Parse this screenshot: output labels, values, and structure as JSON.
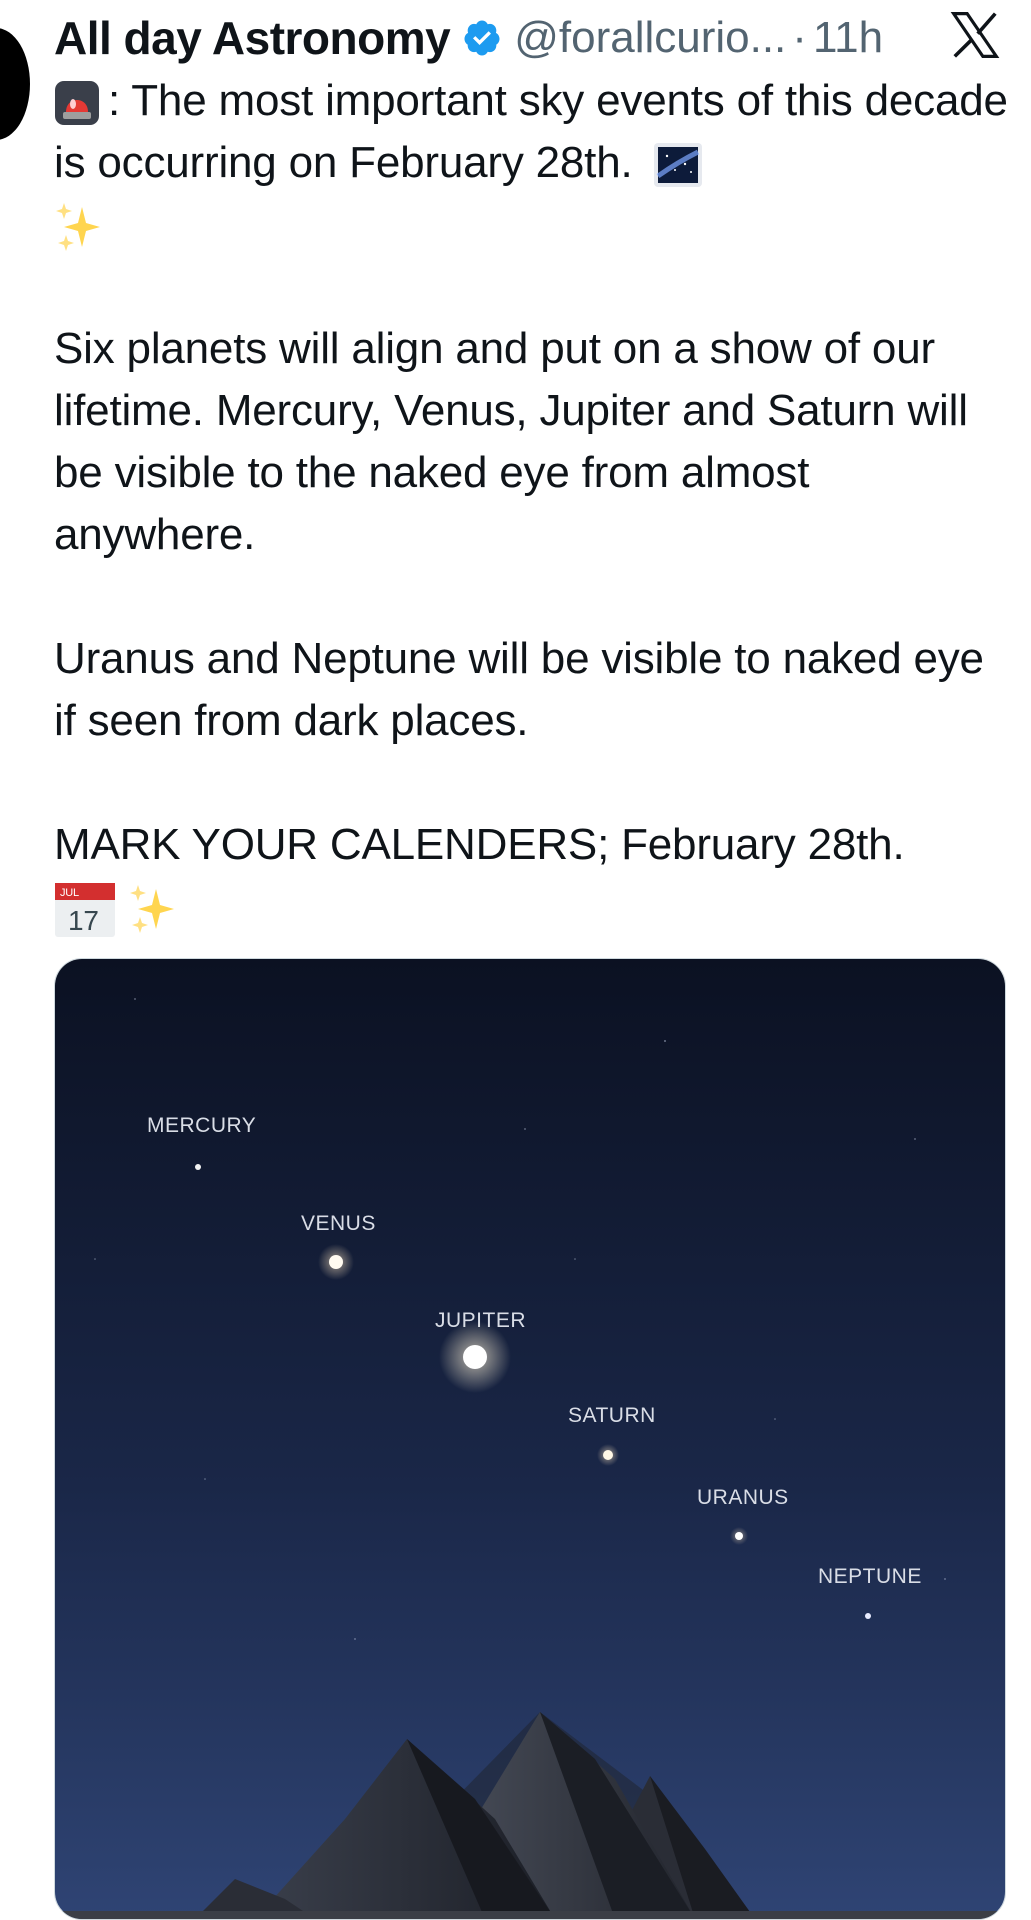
{
  "author": {
    "display_name": "All day Astronomy",
    "handle": "@forallcurio...",
    "separator": "·",
    "time": "11h",
    "verified_icon": "verified-badge-icon",
    "platform_icon": "x-logo-icon"
  },
  "tweet": {
    "line1": ": The most important sky events of this decade is occurring on February 28th.",
    "line1_emoji": "rotating-light-icon",
    "line1_end_emoji": "milky-way-icon",
    "para2": "Six planets will align and put on a show of our lifetime. Mercury, Venus, Jupiter and Saturn will be visible to the naked eye from almost anywhere.",
    "para3": "Uranus and Neptune will be visible to naked eye if seen from dark places.",
    "para4": "MARK YOUR CALENDERS; February 28th.",
    "calendar_emoji": {
      "month": "JUL",
      "day": "17"
    },
    "sparkles_emoji": "sparkles-icon"
  },
  "media": {
    "planets": [
      {
        "label": "MERCURY"
      },
      {
        "label": "VENUS"
      },
      {
        "label": "JUPITER"
      },
      {
        "label": "SATURN"
      },
      {
        "label": "URANUS"
      },
      {
        "label": "NEPTUNE"
      }
    ],
    "colors": {
      "sky_top": "#0b1122",
      "sky_bottom": "#2b3e6c"
    }
  },
  "colors": {
    "text": "#0f1419",
    "muted": "#536471",
    "verified": "#1d9bf0"
  }
}
